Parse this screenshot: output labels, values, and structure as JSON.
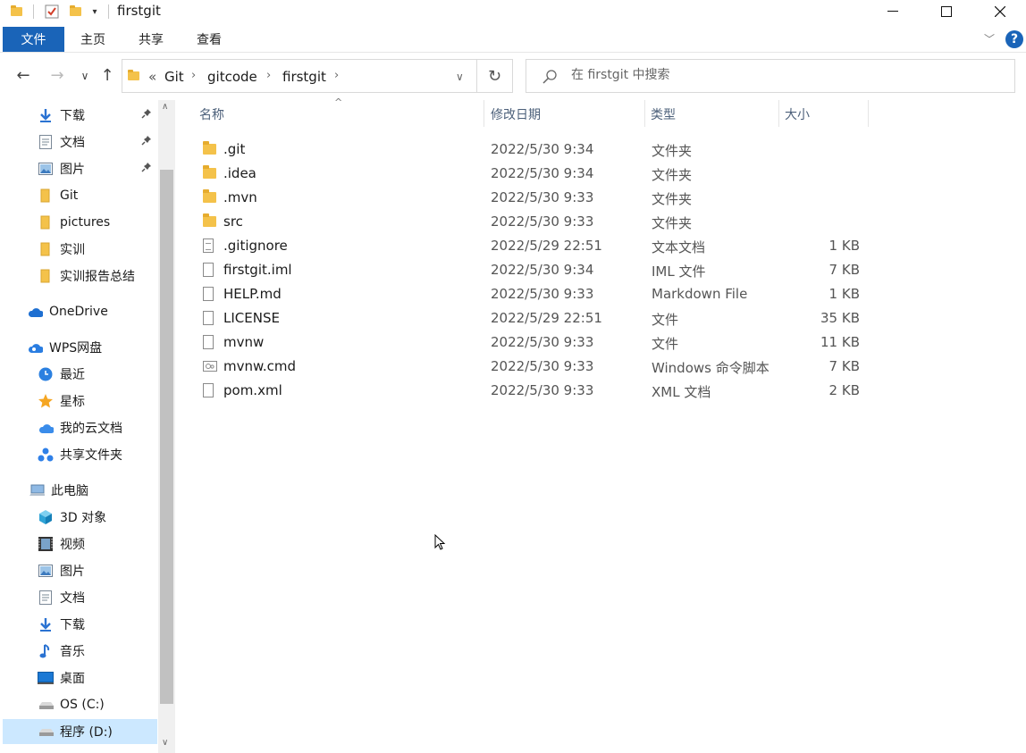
{
  "window": {
    "title": "firstgit"
  },
  "ribbon": {
    "tabs": [
      "文件",
      "主页",
      "共享",
      "查看"
    ],
    "help": "?"
  },
  "address": {
    "overflow": "«",
    "crumbs": [
      "Git",
      "gitcode",
      "firstgit"
    ]
  },
  "search": {
    "placeholder": "在 firstgit 中搜索"
  },
  "sidebar": {
    "items": [
      {
        "label": "下载",
        "icon": "download-icon",
        "pinned": true
      },
      {
        "label": "文档",
        "icon": "document-icon",
        "pinned": true
      },
      {
        "label": "图片",
        "icon": "picture-icon",
        "pinned": true
      },
      {
        "label": "Git",
        "icon": "folder-icon"
      },
      {
        "label": "pictures",
        "icon": "folder-icon"
      },
      {
        "label": "实训",
        "icon": "folder-icon"
      },
      {
        "label": "实训报告总结",
        "icon": "folder-icon"
      },
      {
        "label": "OneDrive",
        "icon": "cloud-icon"
      },
      {
        "label": "WPS网盘",
        "icon": "wps-cloud-icon"
      },
      {
        "label": "最近",
        "icon": "clock-icon"
      },
      {
        "label": "星标",
        "icon": "star-icon"
      },
      {
        "label": "我的云文档",
        "icon": "cloud-doc-icon"
      },
      {
        "label": "共享文件夹",
        "icon": "share-icon"
      },
      {
        "label": "此电脑",
        "icon": "computer-icon"
      },
      {
        "label": "3D 对象",
        "icon": "cube-icon"
      },
      {
        "label": "视频",
        "icon": "video-icon"
      },
      {
        "label": "图片",
        "icon": "picture-icon"
      },
      {
        "label": "文档",
        "icon": "document-icon"
      },
      {
        "label": "下载",
        "icon": "download-icon"
      },
      {
        "label": "音乐",
        "icon": "music-icon"
      },
      {
        "label": "桌面",
        "icon": "desktop-icon"
      },
      {
        "label": "OS (C:)",
        "icon": "drive-icon"
      },
      {
        "label": "程序 (D:)",
        "icon": "drive-icon",
        "selected": true
      }
    ]
  },
  "columns": {
    "name": "名称",
    "date": "修改日期",
    "type": "类型",
    "size": "大小"
  },
  "files": [
    {
      "name": ".git",
      "date": "2022/5/30 9:34",
      "type": "文件夹",
      "size": "",
      "kind": "folder"
    },
    {
      "name": ".idea",
      "date": "2022/5/30 9:34",
      "type": "文件夹",
      "size": "",
      "kind": "folder"
    },
    {
      "name": ".mvn",
      "date": "2022/5/30 9:33",
      "type": "文件夹",
      "size": "",
      "kind": "folder"
    },
    {
      "name": "src",
      "date": "2022/5/30 9:33",
      "type": "文件夹",
      "size": "",
      "kind": "folder"
    },
    {
      "name": ".gitignore",
      "date": "2022/5/29 22:51",
      "type": "文本文档",
      "size": "1 KB",
      "kind": "text"
    },
    {
      "name": "firstgit.iml",
      "date": "2022/5/30 9:34",
      "type": "IML 文件",
      "size": "7 KB",
      "kind": "file"
    },
    {
      "name": "HELP.md",
      "date": "2022/5/30 9:33",
      "type": "Markdown File",
      "size": "1 KB",
      "kind": "file"
    },
    {
      "name": "LICENSE",
      "date": "2022/5/29 22:51",
      "type": "文件",
      "size": "35 KB",
      "kind": "file"
    },
    {
      "name": "mvnw",
      "date": "2022/5/30 9:33",
      "type": "文件",
      "size": "11 KB",
      "kind": "file"
    },
    {
      "name": "mvnw.cmd",
      "date": "2022/5/30 9:33",
      "type": "Windows 命令脚本",
      "size": "7 KB",
      "kind": "script"
    },
    {
      "name": "pom.xml",
      "date": "2022/5/30 9:33",
      "type": "XML 文档",
      "size": "2 KB",
      "kind": "file"
    }
  ],
  "colors": {
    "accent": "#1a64b8",
    "selection": "#cce8ff",
    "folder": "#f4c24a"
  }
}
